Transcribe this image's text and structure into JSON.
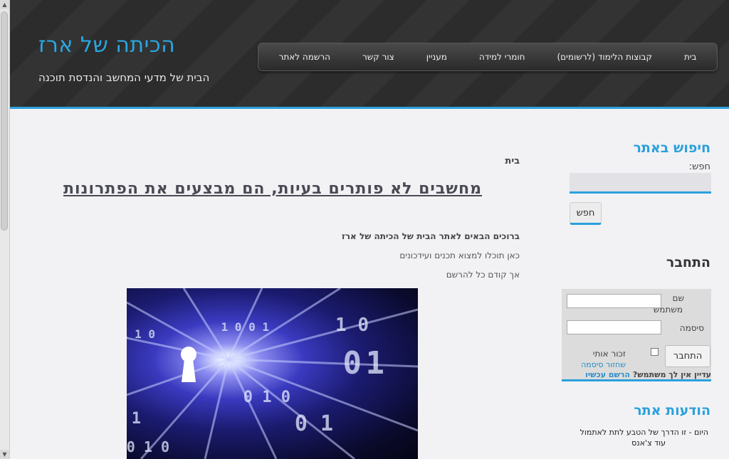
{
  "header": {
    "site_title": "הכיתה של ארז",
    "tagline": "הבית של מדעי המחשב והנדסת תוכנה"
  },
  "nav": {
    "items": [
      {
        "label": "בית"
      },
      {
        "label": "קבוצות הלימוד (לרשומים)"
      },
      {
        "label": "חומרי למידה"
      },
      {
        "label": "מעניין"
      },
      {
        "label": "צור קשר"
      },
      {
        "label": "הרשמה לאתר"
      }
    ]
  },
  "main": {
    "breadcrumb": "בית",
    "post_title": "מחשבים לא פותרים בעיות, הם מבצעים את הפתרונות",
    "intro_bold": "ברוכים הבאים לאתר הבית של הכיתה של ארז",
    "intro_line1": "כאן תוכלו למצוא תכנים ועידכונים",
    "intro_line2": "אך קודם כל להרשם"
  },
  "sidebar": {
    "search": {
      "heading": "חיפוש באתר",
      "label": "חפש:",
      "button": "חפש"
    },
    "login": {
      "heading": "התחבר",
      "username_label_1": "שם",
      "username_label_2": "משתמש",
      "password_label": "סיסמה",
      "remember_label": "זכור אותי",
      "forgot_link": "שחזור סיסמה",
      "button": "התחבר",
      "no_user_text": "עדיין אין לך משתמש?",
      "register_link": "הרשם עכשיו"
    },
    "notices": {
      "heading": "הודעות אתר",
      "line1": "היום - זו הדרך של הטבע לתת לאתמול",
      "line2": "עוד צ'אנס"
    }
  },
  "colors": {
    "accent": "#2aa0dc",
    "header_bg": "#2c2c2c",
    "page_bg": "#f2f2f5"
  }
}
